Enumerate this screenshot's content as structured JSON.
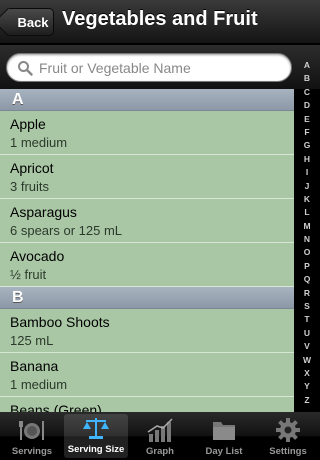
{
  "nav": {
    "back_label": "Back",
    "title": "Vegetables and Fruit"
  },
  "search": {
    "placeholder": "Fruit or Vegetable Name"
  },
  "sections": [
    {
      "header": "A",
      "items": [
        {
          "name": "Apple",
          "serving": "1 medium"
        },
        {
          "name": "Apricot",
          "serving": "3 fruits"
        },
        {
          "name": "Asparagus",
          "serving": "6 spears or 125 mL"
        },
        {
          "name": "Avocado",
          "serving": "½ fruit"
        }
      ]
    },
    {
      "header": "B",
      "items": [
        {
          "name": "Bamboo Shoots",
          "serving": "125 mL"
        },
        {
          "name": "Banana",
          "serving": "1 medium"
        },
        {
          "name": "Beans (Green)",
          "serving": ""
        }
      ]
    }
  ],
  "index_letters": [
    "A",
    "B",
    "C",
    "D",
    "E",
    "F",
    "G",
    "H",
    "I",
    "J",
    "K",
    "L",
    "M",
    "N",
    "O",
    "P",
    "Q",
    "R",
    "S",
    "T",
    "U",
    "V",
    "W",
    "X",
    "Y",
    "Z"
  ],
  "tabs": [
    {
      "label": "Servings",
      "icon": "plate-cutlery-icon",
      "active": false
    },
    {
      "label": "Serving Size",
      "icon": "scale-icon",
      "active": true
    },
    {
      "label": "Graph",
      "icon": "bar-graph-icon",
      "active": false
    },
    {
      "label": "Day List",
      "icon": "folder-icon",
      "active": false
    },
    {
      "label": "Settings",
      "icon": "gear-icon",
      "active": false
    }
  ],
  "colors": {
    "row_bg": "#a9c7a5",
    "section_bg": "#97a3b1",
    "nav_bg": "#1e1e1e"
  }
}
